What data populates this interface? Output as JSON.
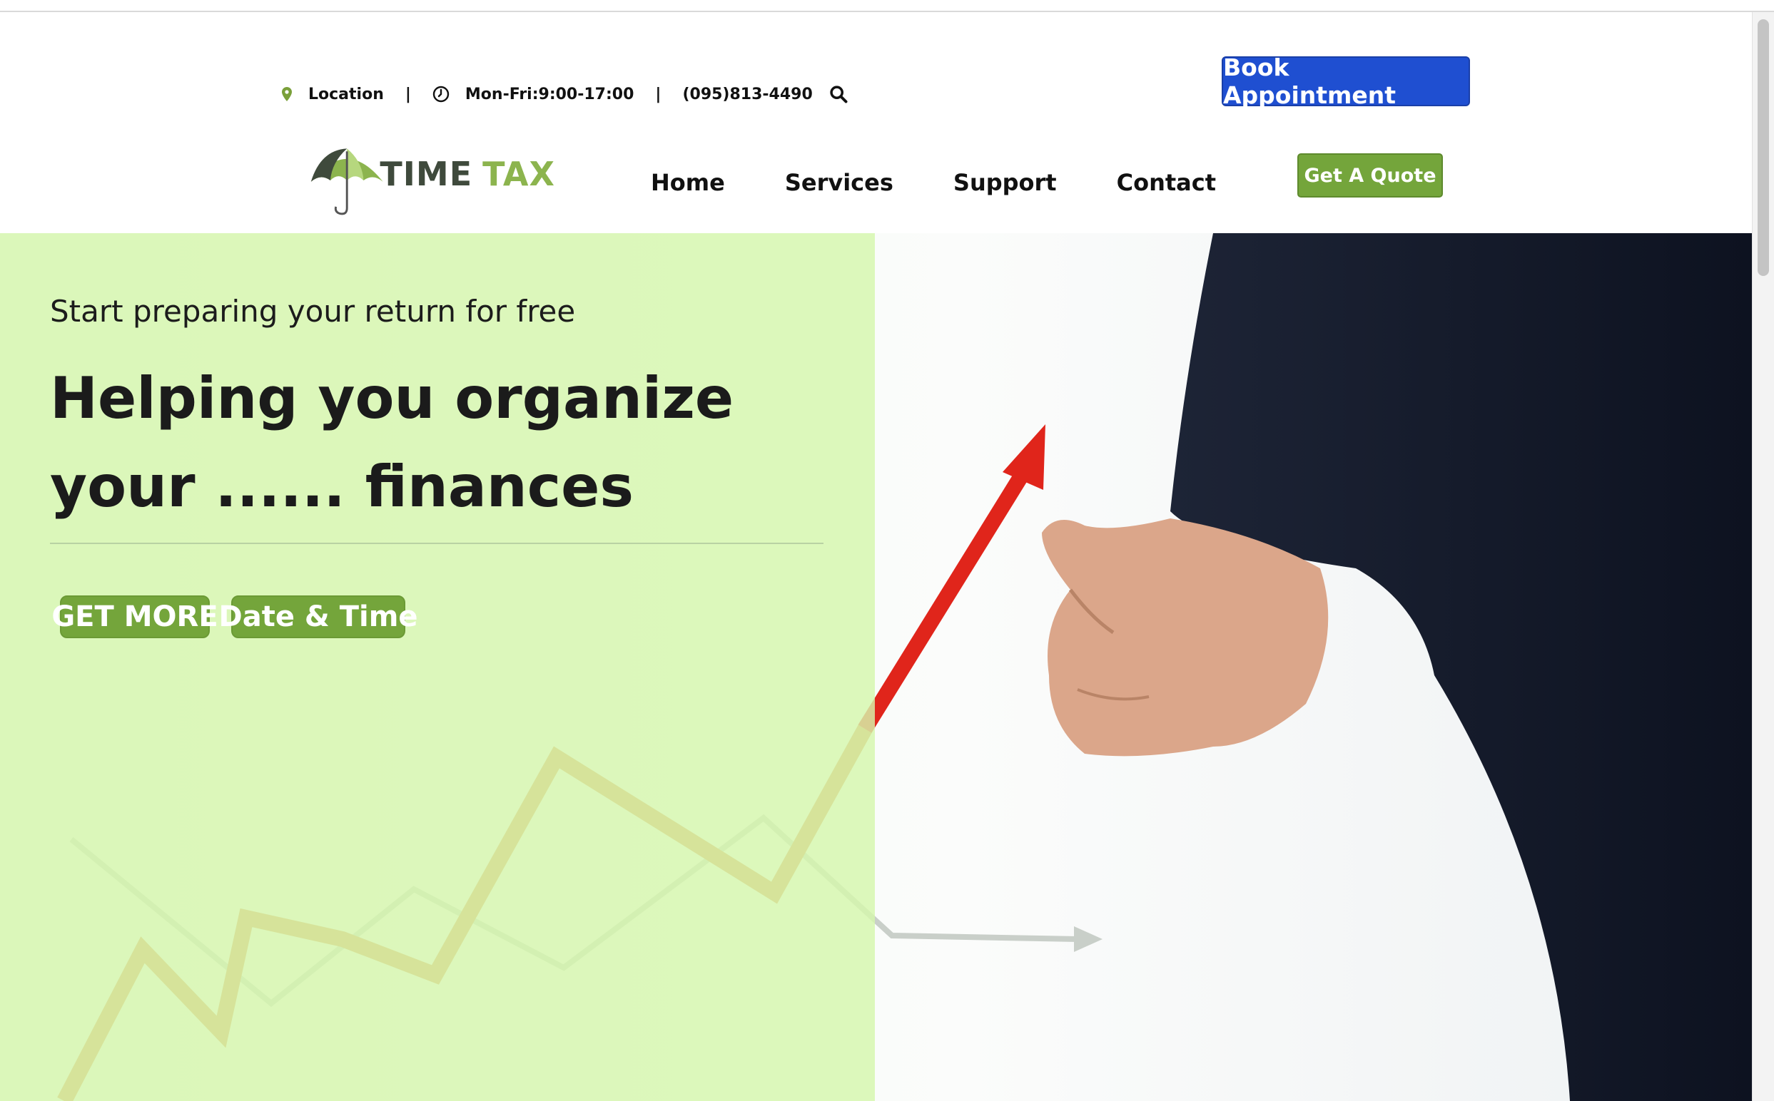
{
  "topbar": {
    "location": "Location",
    "separator": "|",
    "hours": "Mon-Fri:9:00-17:00",
    "phone": "(095)813-4490"
  },
  "header": {
    "book_label": "Book Appointment",
    "quote_label": "Get A Quote"
  },
  "logo": {
    "part1": "TIME",
    "part2": "TAX"
  },
  "nav": {
    "items": [
      "Home",
      "Services",
      "Support",
      "Contact"
    ]
  },
  "hero": {
    "subtitle": "Start preparing your return for free",
    "title_line1": "Helping you organize",
    "title_line2": "your ...... finances",
    "btn_more": "GET MORE",
    "btn_date": "Date & Time"
  },
  "colors": {
    "book_button": "#1f4fd1",
    "green_accent": "#74a53b",
    "overlay": "#d6f6ad"
  },
  "icons": {
    "location": "map-pin-icon",
    "hours": "clock-icon",
    "search": "search-icon"
  }
}
